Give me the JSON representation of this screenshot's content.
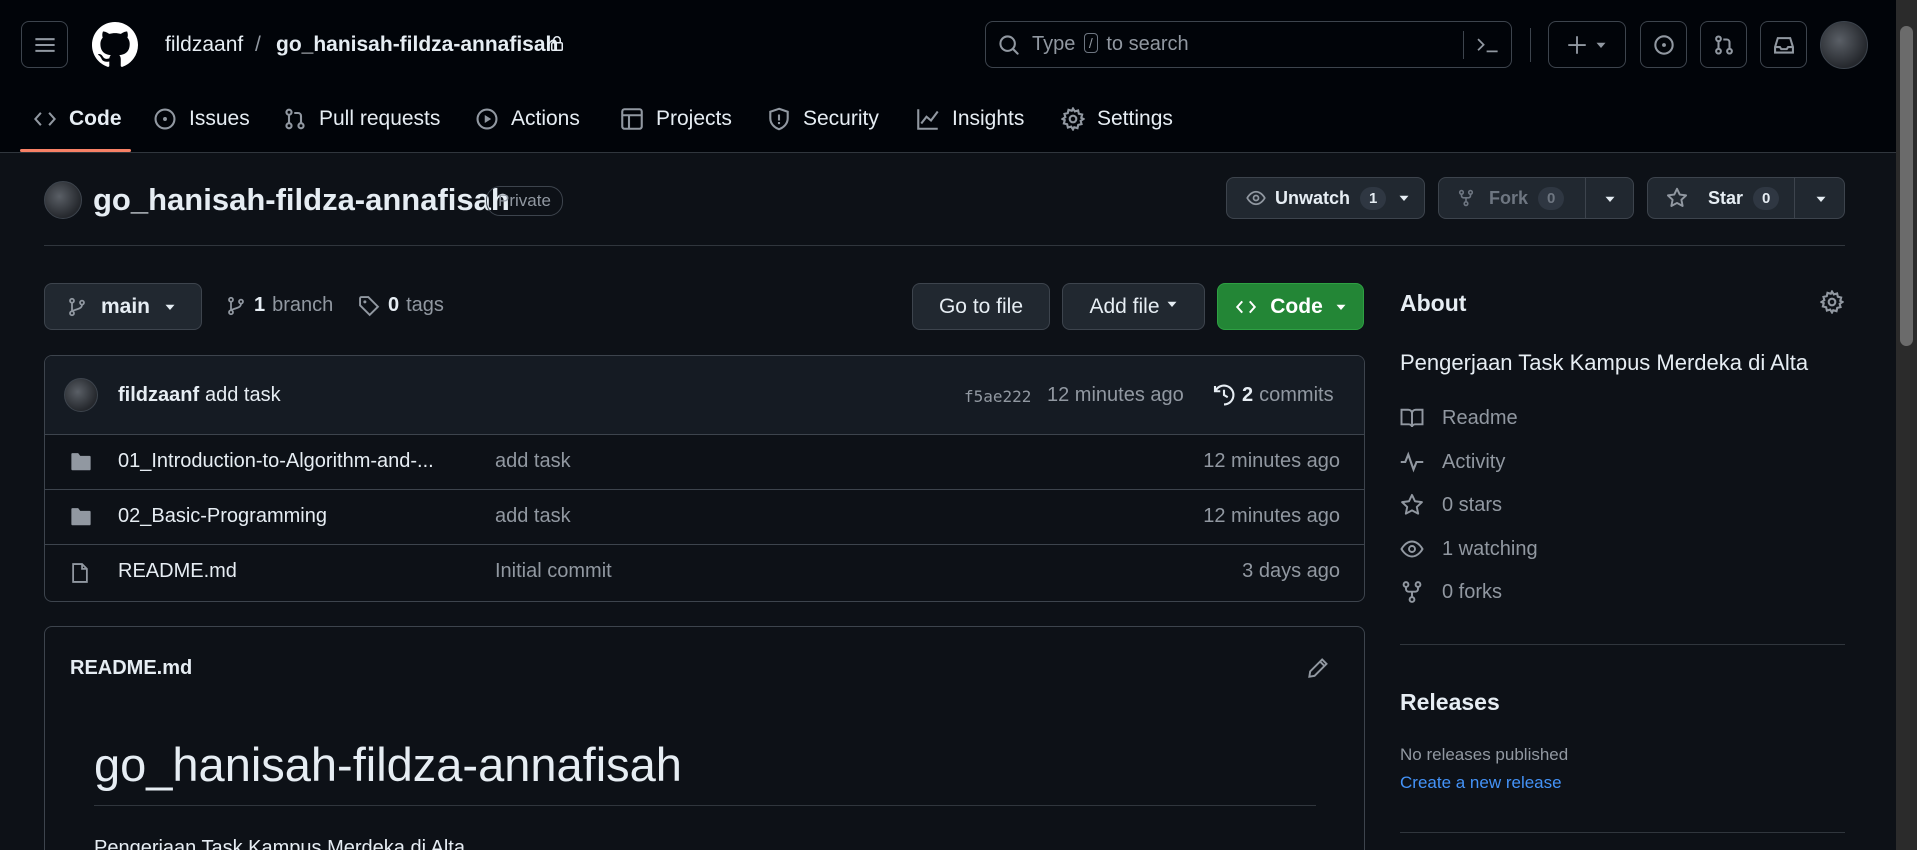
{
  "header": {
    "owner": "fildzaanf",
    "separator": "/",
    "repo": "go_hanisah-fildza-annafisah",
    "search_prefix": "Type",
    "search_key": "/",
    "search_suffix": "to search"
  },
  "nav_tabs": [
    {
      "label": "Code",
      "icon": "code-icon"
    },
    {
      "label": "Issues",
      "icon": "issue-icon"
    },
    {
      "label": "Pull requests",
      "icon": "pull-request-icon"
    },
    {
      "label": "Actions",
      "icon": "play-icon"
    },
    {
      "label": "Projects",
      "icon": "table-icon"
    },
    {
      "label": "Security",
      "icon": "shield-icon"
    },
    {
      "label": "Insights",
      "icon": "graph-icon"
    },
    {
      "label": "Settings",
      "icon": "gear-icon"
    }
  ],
  "repo_head": {
    "title": "go_hanisah-fildza-annafisah",
    "visibility": "Private",
    "watch_label": "Unwatch",
    "watch_count": "1",
    "fork_label": "Fork",
    "fork_count": "0",
    "star_label": "Star",
    "star_count": "0"
  },
  "branch_bar": {
    "branch": "main",
    "branch_count": "1",
    "branch_word": "branch",
    "tag_count": "0",
    "tag_word": "tags",
    "go_to_file": "Go to file",
    "add_file": "Add file",
    "code": "Code"
  },
  "latest_commit": {
    "author": "fildzaanf",
    "message": "add task",
    "sha": "f5ae222",
    "time": "12 minutes ago",
    "commit_count": "2",
    "commit_word": "commits"
  },
  "files": [
    {
      "type": "folder",
      "name": "01_Introduction-to-Algorithm-and-...",
      "message": "add task",
      "date": "12 minutes ago"
    },
    {
      "type": "folder",
      "name": "02_Basic-Programming",
      "message": "add task",
      "date": "12 minutes ago"
    },
    {
      "type": "file",
      "name": "README.md",
      "message": "Initial commit",
      "date": "3 days ago"
    }
  ],
  "readme": {
    "filename": "README.md",
    "heading": "go_hanisah-fildza-annafisah",
    "body": "Pengerjaan Task Kampus Merdeka di Alta"
  },
  "about": {
    "title": "About",
    "description": "Pengerjaan Task Kampus Merdeka di Alta",
    "items": [
      {
        "label": "Readme",
        "icon": "book-icon"
      },
      {
        "label": "Activity",
        "icon": "pulse-icon"
      },
      {
        "label": "0 stars",
        "icon": "star-icon"
      },
      {
        "label": "1 watching",
        "icon": "eye-icon"
      },
      {
        "label": "0 forks",
        "icon": "fork-icon"
      }
    ]
  },
  "releases": {
    "title": "Releases",
    "empty_text": "No releases published",
    "create_link": "Create a new release"
  },
  "colors": {
    "background": "#0d1117",
    "header_bg": "#010409",
    "accent_underline": "#f78166",
    "primary_button": "#238636",
    "link": "#4493f8"
  }
}
